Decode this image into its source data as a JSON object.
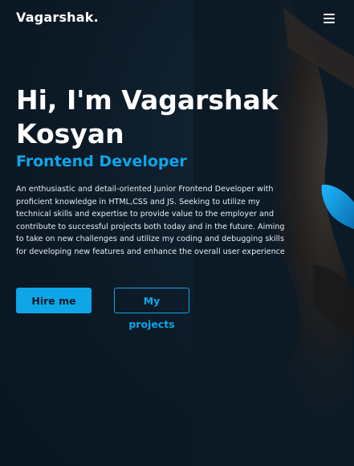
{
  "nav": {
    "logo": "Vagarshak.",
    "menu_icon": "hamburger-menu-icon"
  },
  "hero": {
    "title": "Hi, I'm Vagarshak Kosyan",
    "subtitle": "Frontend Developer",
    "description": "An enthusiastic and detail-oriented Junior Frontend Developer with proficient knowledge in HTML,CSS and JS. Seeking to utilize my technical skills and expertise to provide value to the employer and contribute to successful projects both today and in the future. Aiming to take on new challenges and utilize my coding and debugging skills for developing new features and enhance the overall user experience",
    "primary_button": "Hire me",
    "secondary_button": "My projects"
  },
  "colors": {
    "accent": "#0ea5e9",
    "background": "#0c1a26",
    "text": "#ffffff"
  }
}
